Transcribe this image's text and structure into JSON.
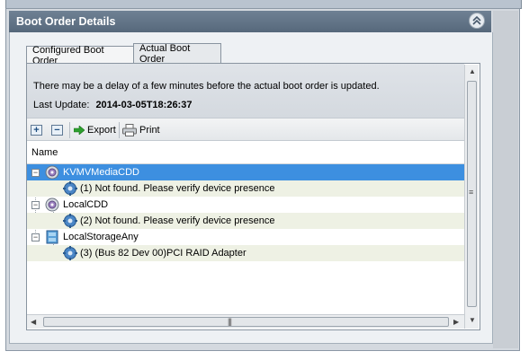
{
  "panel": {
    "title": "Boot Order Details"
  },
  "tabs": [
    {
      "label": "Configured Boot Order",
      "active": false
    },
    {
      "label": "Actual Boot Order",
      "active": true
    }
  ],
  "info": {
    "message": "There may be a delay of a few minutes before the actual boot order is updated.",
    "last_update_label": "Last Update:",
    "last_update_value": "2014-03-05T18:26:37"
  },
  "toolbar": {
    "expand_icon": "plus-icon",
    "collapse_icon": "minus-icon",
    "export_label": "Export",
    "print_label": "Print"
  },
  "table": {
    "column_name": "Name"
  },
  "tree": [
    {
      "label": "KVMVMediaCDD",
      "icon": "cd-drive-icon",
      "level": 0,
      "selected": true
    },
    {
      "label": "(1) Not found. Please verify device presence",
      "icon": "gear-icon",
      "level": 1
    },
    {
      "label": "LocalCDD",
      "icon": "cd-drive-icon",
      "level": 0
    },
    {
      "label": "(2) Not found. Please verify device presence",
      "icon": "gear-icon",
      "level": 1
    },
    {
      "label": "LocalStorageAny",
      "icon": "storage-icon",
      "level": 0
    },
    {
      "label": "(3) (Bus 82 Dev 00)PCI RAID Adapter",
      "icon": "gear-icon",
      "level": 1
    }
  ],
  "colors": {
    "header_bg": "#5f7387",
    "selection": "#3d8fe0",
    "alt_row": "#eef1e4"
  }
}
